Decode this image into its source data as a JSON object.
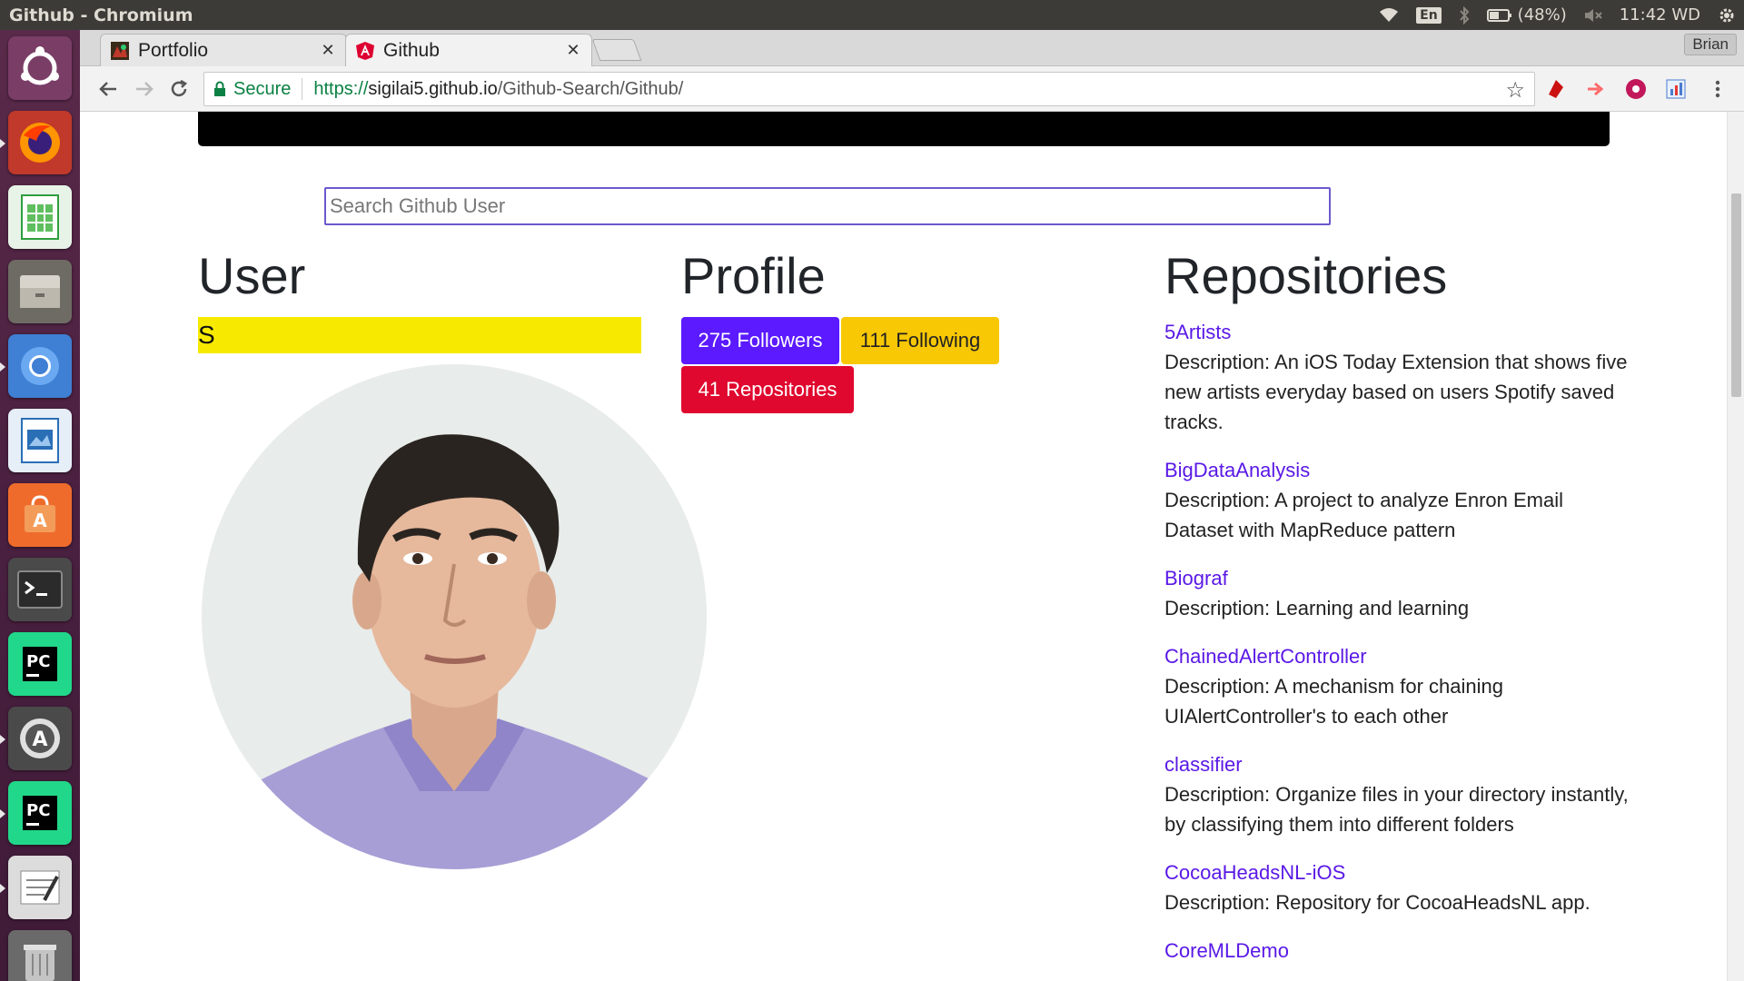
{
  "os_panel": {
    "window_title": "Github - Chromium",
    "keyboard_layout": "En",
    "battery": "(48%)",
    "clock": "11:42 WD"
  },
  "launcher": {
    "items": [
      {
        "name": "ubuntu-dash-icon",
        "color": "#e95420"
      },
      {
        "name": "firefox-icon",
        "color": "#ff7139"
      },
      {
        "name": "libreoffice-calc-icon",
        "color": "#2e9e3e"
      },
      {
        "name": "files-icon",
        "color": "#8e8a83"
      },
      {
        "name": "chromium-icon",
        "color": "#4a8cdb"
      },
      {
        "name": "libreoffice-impress-icon",
        "color": "#2a6fb6"
      },
      {
        "name": "software-center-icon",
        "color": "#ef6b2c"
      },
      {
        "name": "terminal-icon",
        "color": "#2b2b2b"
      },
      {
        "name": "pycharm-icon",
        "color": "#21d789"
      },
      {
        "name": "software-updater-icon",
        "color": "#5a5a5a"
      },
      {
        "name": "pycharm-edu-icon",
        "color": "#21d789"
      },
      {
        "name": "text-editor-icon",
        "color": "#cfcfcf"
      },
      {
        "name": "trash-icon",
        "color": "#9a9a9a"
      }
    ]
  },
  "browser": {
    "tabs": [
      {
        "title": "Portfolio",
        "favicon": "portfolio-favicon-icon",
        "active": false
      },
      {
        "title": "Github",
        "favicon": "angular-favicon-icon",
        "active": true
      }
    ],
    "profile_name": "Brian",
    "security_label": "Secure",
    "url_scheme": "https://",
    "url_host": "sigilai5.github.io",
    "url_path": "/Github-Search/Github/"
  },
  "page": {
    "search_placeholder": "Search Github User",
    "user_heading": "User",
    "user_name": "S",
    "profile_heading": "Profile",
    "followers_label": "275 Followers",
    "following_label": "111 Following",
    "repositories_label": "41 Repositories",
    "repositories_heading": "Repositories",
    "repositories": [
      {
        "name": "5Artists",
        "description": "Description: An iOS Today Extension that shows five new artists everyday based on users Spotify saved tracks."
      },
      {
        "name": "BigDataAnalysis",
        "description": "Description: A project to analyze Enron Email Dataset with MapReduce pattern"
      },
      {
        "name": "Biograf",
        "description": "Description: Learning and learning"
      },
      {
        "name": "ChainedAlertController",
        "description": "Description: A mechanism for chaining UIAlertController's to each other"
      },
      {
        "name": "classifier",
        "description": "Description: Organize files in your directory instantly, by classifying them into different folders"
      },
      {
        "name": "CocoaHeadsNL-iOS",
        "description": "Description: Repository for CocoaHeadsNL app."
      },
      {
        "name": "CoreMLDemo",
        "description": ""
      }
    ]
  },
  "colors": {
    "followers_badge": "#5b1aff",
    "following_badge": "#f8c804",
    "repos_badge": "#e0082e",
    "user_highlight": "#f7ea00",
    "repo_link": "#5a19e6"
  }
}
